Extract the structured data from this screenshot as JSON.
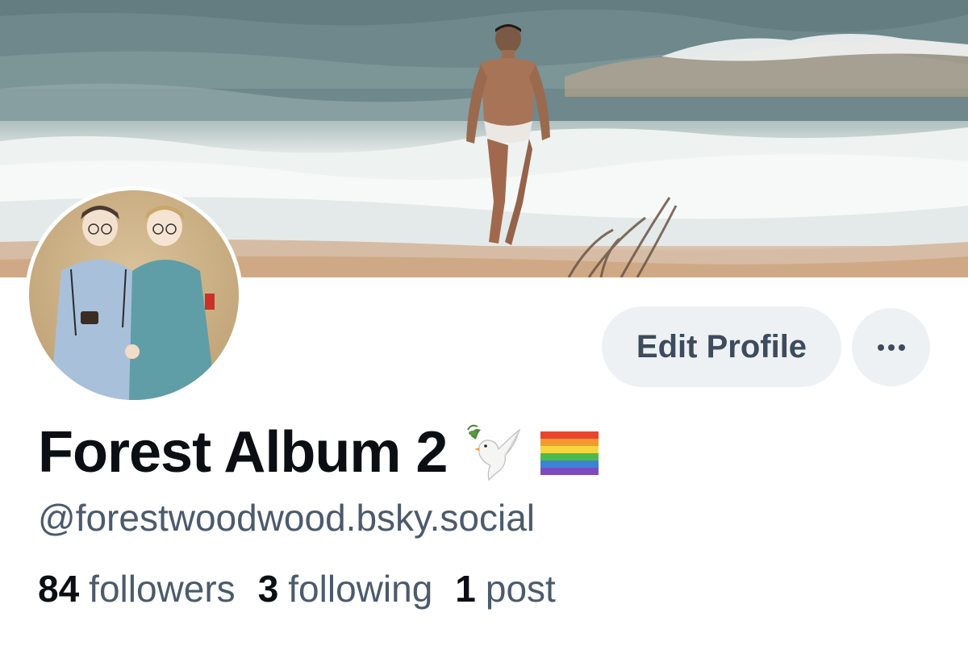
{
  "profile": {
    "display_name": "Forest Album 2",
    "name_emojis": [
      "dove-icon",
      "rainbow-flag-icon"
    ],
    "handle": "@forestwoodwood.bsky.social",
    "banner": "banner-image",
    "avatar": "avatar-image"
  },
  "actions": {
    "edit_label": "Edit Profile",
    "more_icon": "ellipsis-icon"
  },
  "stats": {
    "followers_count": "84",
    "followers_label": "followers",
    "following_count": "3",
    "following_label": "following",
    "posts_count": "1",
    "posts_label": "post"
  },
  "colors": {
    "name": "#0b0f14",
    "secondary_text": "#4b5a6c",
    "button_bg": "#eef1f4",
    "button_text": "#3d4b5c"
  }
}
